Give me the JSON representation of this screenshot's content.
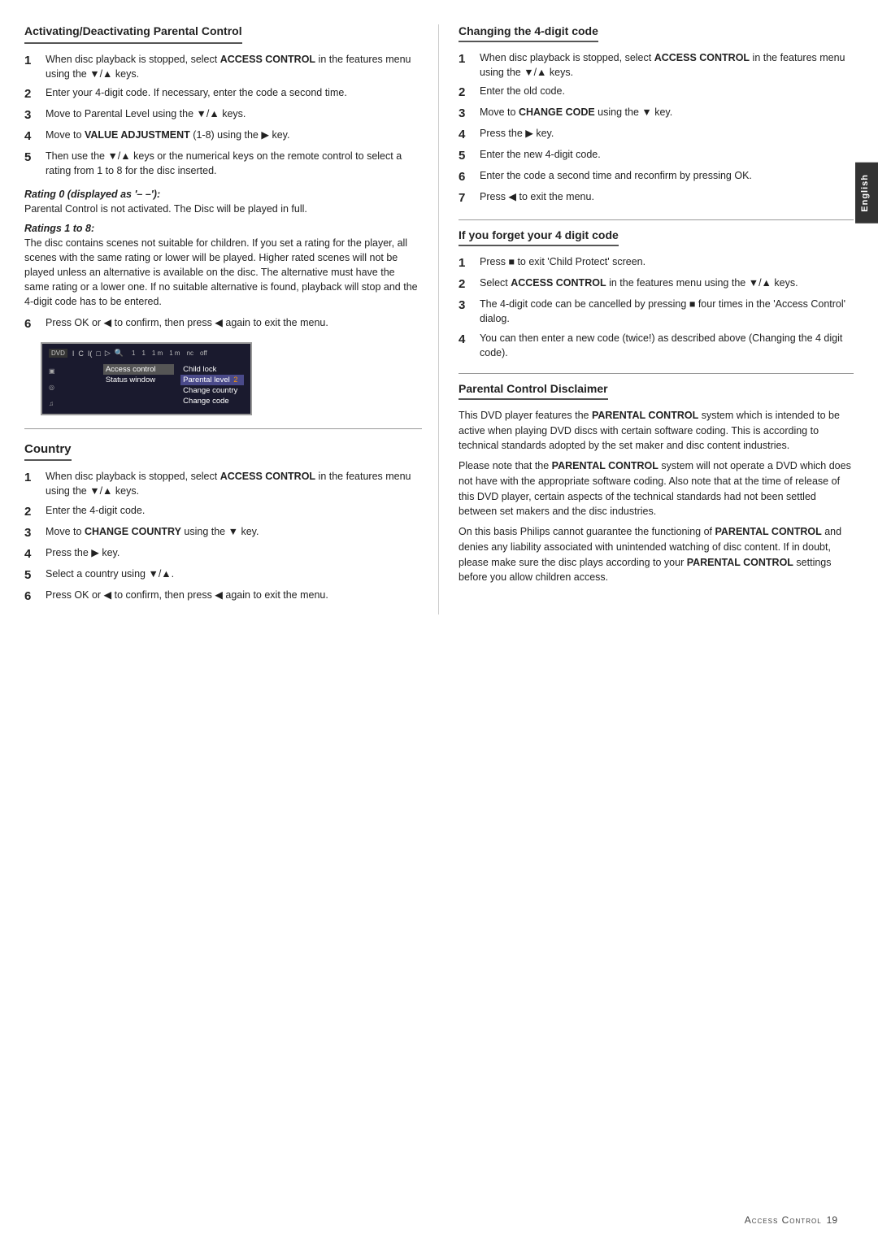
{
  "page": {
    "title": "Access Control",
    "page_number": "19",
    "side_tab_label": "English"
  },
  "left_column": {
    "section1": {
      "title": "Activating/Deactivating Parental Control",
      "items": [
        {
          "num": "1",
          "text": "When disc playback is stopped, select ",
          "bold": "ACCESS CONTROL",
          "text2": " in the features menu using the ▼/▲ keys."
        },
        {
          "num": "2",
          "text": "Enter your 4-digit code. If necessary, enter the code a second time."
        },
        {
          "num": "3",
          "text": "Move to Parental Level using the ▼/▲ keys."
        },
        {
          "num": "4",
          "text": "Move to ",
          "bold": "VALUE ADJUSTMENT",
          "text2": " (1-8) using the ▶ key."
        },
        {
          "num": "5",
          "text": "Then use the ▼/▲ keys or the numerical keys on the remote control to select a rating from 1 to 8 for the disc inserted."
        }
      ],
      "rating0_title": "Rating 0 (displayed as '– –'):",
      "rating0_text": "Parental Control is not activated. The Disc will be played in full.",
      "rating1_title": "Ratings 1 to 8:",
      "rating1_text": "The disc contains scenes not suitable for children. If you set a rating for the player, all scenes with the same rating or lower will be played. Higher rated scenes will not be played unless an alternative is available on the disc. The alternative must have the same rating or a lower one. If no suitable alternative is found, playback will stop and the 4-digit code has to be entered.",
      "item6": {
        "num": "6",
        "text": "Press OK or ◀ to confirm, then press ◀ again to exit the menu."
      }
    },
    "country_section": {
      "title": "Country",
      "items": [
        {
          "num": "1",
          "text": "When disc playback is stopped, select ",
          "bold": "ACCESS CONTROL",
          "text2": " in the features menu using the ▼/▲ keys."
        },
        {
          "num": "2",
          "text": "Enter the 4-digit code."
        },
        {
          "num": "3",
          "text": "Move to ",
          "bold": "CHANGE COUNTRY",
          "text2": " using the ▼ key."
        },
        {
          "num": "4",
          "text": "Press the ▶ key."
        },
        {
          "num": "5",
          "text": "Select a country using ▼/▲."
        },
        {
          "num": "6",
          "text": "Press OK or ◀ to confirm, then press ◀ again to exit the menu."
        }
      ]
    }
  },
  "right_column": {
    "section1": {
      "title": "Changing the 4-digit code",
      "items": [
        {
          "num": "1",
          "text": "When disc playback is stopped, select ",
          "bold": "ACCESS CONTROL",
          "text2": " in the features menu using the ▼/▲ keys."
        },
        {
          "num": "2",
          "text": "Enter the old code."
        },
        {
          "num": "3",
          "text": "Move to ",
          "bold": "CHANGE CODE",
          "text2": " using the ▼ key."
        },
        {
          "num": "4",
          "text": "Press the ▶ key."
        },
        {
          "num": "5",
          "text": "Enter the new 4-digit code."
        },
        {
          "num": "6",
          "text": "Enter the code a second time and reconfirm by pressing OK."
        },
        {
          "num": "7",
          "text": "Press ◀ to exit the menu."
        }
      ]
    },
    "section2": {
      "title": "If you forget your 4 digit code",
      "items": [
        {
          "num": "1",
          "text": "Press ■ to exit 'Child Protect' screen."
        },
        {
          "num": "2",
          "text": "Select ",
          "bold": "ACCESS CONTROL",
          "text2": " in the features menu using the ▼/▲ keys."
        },
        {
          "num": "3",
          "text": "The 4-digit code can be cancelled by pressing ■ four times in the 'Access Control' dialog."
        },
        {
          "num": "4",
          "text": "You can then enter a new code (twice!) as described above (Changing the 4 digit code)."
        }
      ]
    },
    "section3": {
      "title": "Parental Control Disclaimer",
      "paragraphs": [
        "This DVD player features the PARENTAL CONTROL system which is intended to be active when playing DVD discs with certain software coding. This is according to technical standards adopted by the set maker and disc content industries.",
        "Please note that the PARENTAL CONTROL system will not operate a DVD which does not have with the appropriate software coding. Also note that at the time of release of this DVD player, certain aspects of the technical standards had not been settled between set makers and the disc industries.",
        "On this basis Philips cannot guarantee the functioning of PARENTAL CONTROL and denies any liability associated with unintended watching of disc content. If in doubt, please make sure the disc plays according to your PARENTAL CONTROL settings before you allow children access."
      ]
    }
  },
  "screen": {
    "icons": [
      "DVD",
      "I",
      "C",
      "I",
      "□",
      "▷",
      "🔍"
    ],
    "times": [
      "1",
      "1",
      "1 m",
      "1 m",
      "nc",
      "off"
    ],
    "menu_items": [
      "Access control",
      "Status window"
    ],
    "submenu_items": [
      "Child lock",
      "Parental level",
      "Change country",
      "Change code"
    ],
    "active_submenu": "Parental level",
    "badge": "2"
  },
  "footer": {
    "title": "Access Control",
    "page": "19"
  }
}
